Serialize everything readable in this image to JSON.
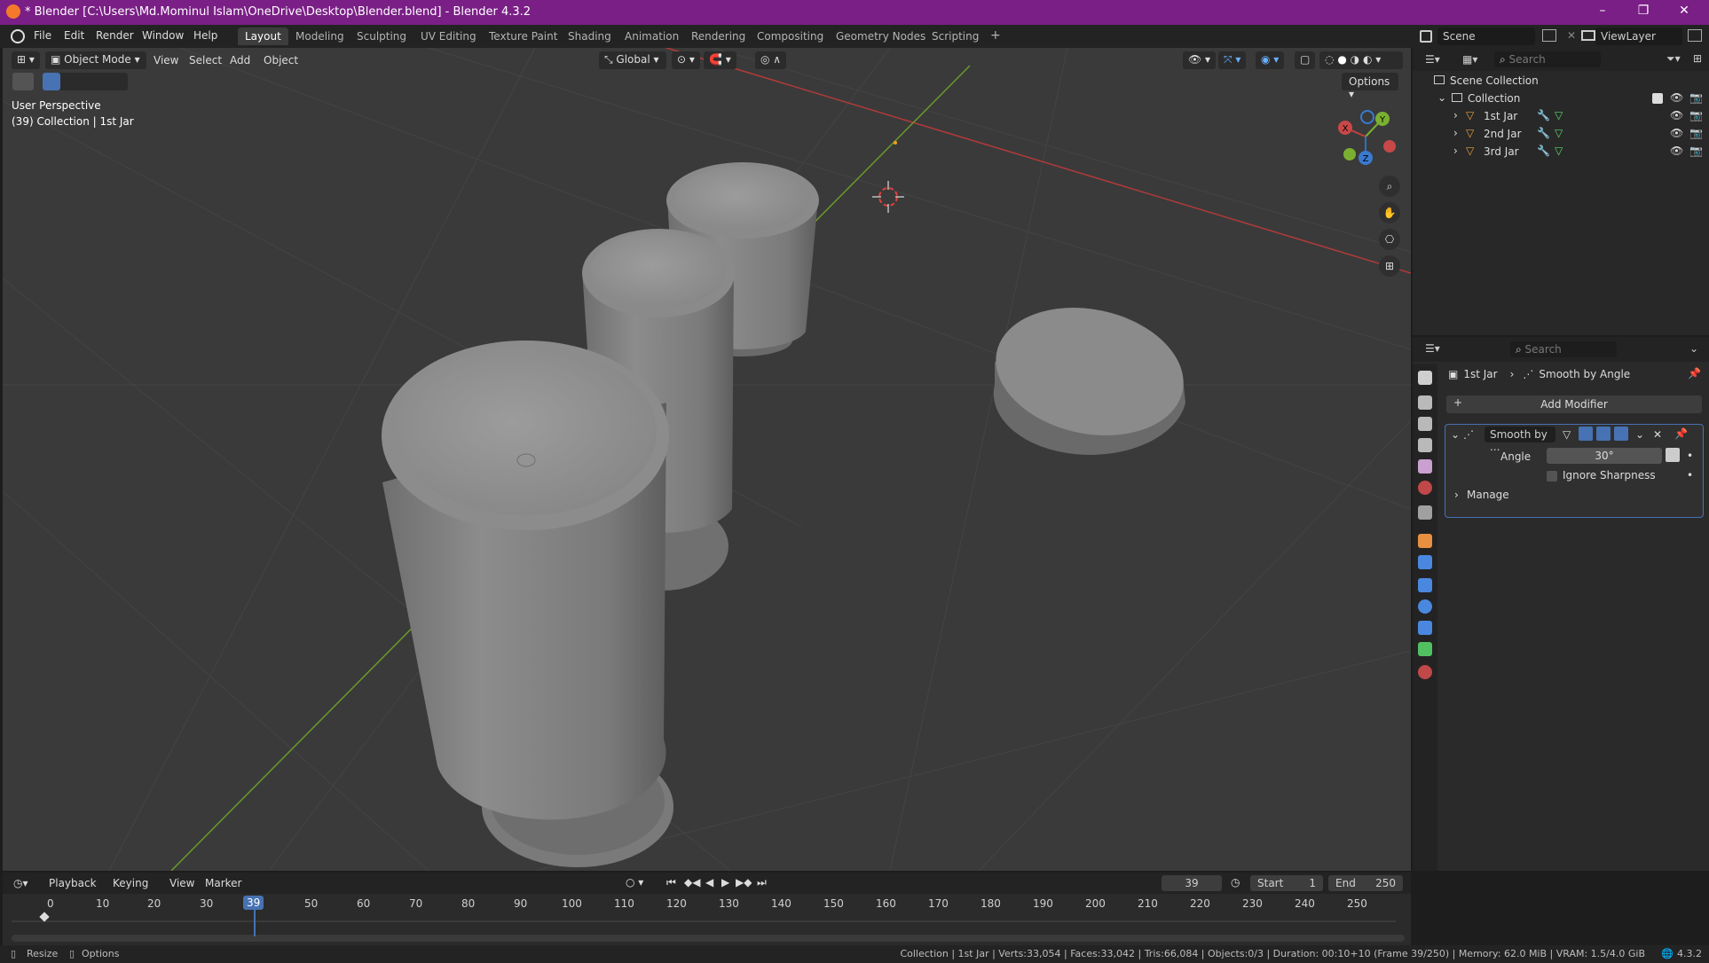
{
  "window": {
    "title": "* Blender [C:\\Users\\Md.Mominul Islam\\OneDrive\\Desktop\\Blender.blend] - Blender 4.3.2",
    "controls": [
      "–",
      "❐",
      "✕"
    ]
  },
  "menubar": {
    "items": [
      "File",
      "Edit",
      "Render",
      "Window",
      "Help"
    ],
    "workspace_tabs": [
      "Layout",
      "Modeling",
      "Sculpting",
      "UV Editing",
      "Texture Paint",
      "Shading",
      "Animation",
      "Rendering",
      "Compositing",
      "Geometry Nodes",
      "Scripting"
    ],
    "active_tab": "Layout",
    "add_tab": "+",
    "scene_label": "Scene",
    "viewlayer_label": "ViewLayer"
  },
  "viewport": {
    "mode": "Object Mode",
    "menus": [
      "View",
      "Select",
      "Add",
      "Object"
    ],
    "transform_orientation": "Global",
    "options_label": "Options",
    "overlay_line1": "User Perspective",
    "overlay_line2": "(39) Collection | 1st Jar",
    "gizmo": {
      "x": "X",
      "y": "Y",
      "z": "Z"
    }
  },
  "outliner": {
    "search_placeholder": "Search",
    "scene_collection": "Scene Collection",
    "collection": "Collection",
    "objects": [
      "1st Jar",
      "2nd Jar",
      "3rd Jar"
    ]
  },
  "properties": {
    "search_placeholder": "Search",
    "breadcrumb_object": "1st Jar",
    "breadcrumb_modifier": "Smooth by Angle",
    "add_modifier": "Add Modifier",
    "modifier_name": "Smooth by ...",
    "angle_label": "Angle",
    "angle_value": "30°",
    "ignore_sharpness": "Ignore Sharpness",
    "manage": "Manage"
  },
  "timeline": {
    "menus": [
      "Playback",
      "Keying",
      "View",
      "Marker"
    ],
    "current_frame": "39",
    "start_label": "Start",
    "start_value": "1",
    "end_label": "End",
    "end_value": "250",
    "ticks": [
      "0",
      "10",
      "20",
      "30",
      "39",
      "50",
      "60",
      "70",
      "80",
      "90",
      "100",
      "110",
      "120",
      "130",
      "140",
      "150",
      "160",
      "170",
      "180",
      "190",
      "200",
      "210",
      "220",
      "230",
      "240",
      "250"
    ]
  },
  "statusbar": {
    "resize": "Resize",
    "options": "Options",
    "stats": "Collection | 1st Jar | Verts:33,054 | Faces:33,042 | Tris:66,084 | Objects:0/3 | Duration: 00:10+10 (Frame 39/250) | Memory: 62.0 MiB | VRAM: 1.5/4.0 GiB",
    "version": "4.3.2"
  }
}
